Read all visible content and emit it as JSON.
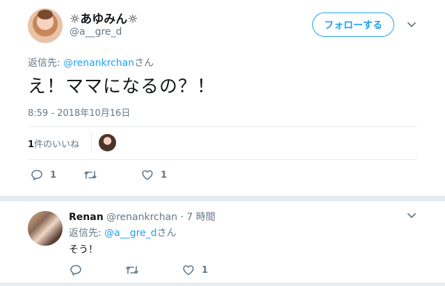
{
  "tweet": {
    "display_name": "☼あゆみん☼",
    "handle": "@a__gre_d",
    "follow_label": "フォローする",
    "reply_prefix": "返信先: ",
    "reply_mention": "@renankrchan",
    "reply_suffix": "さん",
    "text": "え！ママになるの？！",
    "timestamp": "8:59 - 2018年10月16日",
    "likes_count": "1",
    "likes_label": "件のいいね",
    "actions": {
      "reply_count": "1",
      "retweet_count": "",
      "like_count": "1"
    }
  },
  "reply": {
    "name": "Renan",
    "handle": "@renankrchan",
    "time": " · 7 時間",
    "reply_prefix": "返信先: ",
    "reply_mention": "@a__gre_d",
    "reply_suffix": "さん",
    "text": "そう！",
    "actions": {
      "reply_count": "",
      "retweet_count": "",
      "like_count": "1"
    }
  },
  "colors": {
    "accent": "#1da1f2",
    "muted": "#657786",
    "text": "#14171a",
    "border": "#e6ecf0"
  }
}
